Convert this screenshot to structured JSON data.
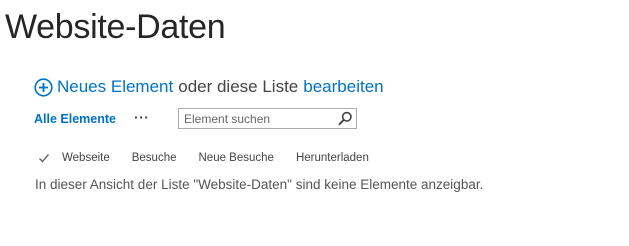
{
  "page": {
    "title": "Website-Daten"
  },
  "command": {
    "new_item_label": "Neues Element",
    "connector_text": "oder diese Liste",
    "edit_label": "bearbeiten"
  },
  "toolbar": {
    "view_label": "Alle Elemente",
    "more_label": "···",
    "search_placeholder": "Element suchen",
    "search_value": ""
  },
  "table": {
    "columns": [
      "Webseite",
      "Besuche",
      "Neue Besuche",
      "Herunterladen"
    ],
    "empty_message": "In dieser Ansicht der Liste \"Website-Daten\" sind keine Elemente anzeigbar."
  },
  "icons": {
    "add": "plus-circle-icon",
    "search": "magnifier-icon",
    "select_all": "checkmark-icon"
  },
  "colors": {
    "link": "#0072c6",
    "title": "#262626",
    "text": "#444444"
  }
}
